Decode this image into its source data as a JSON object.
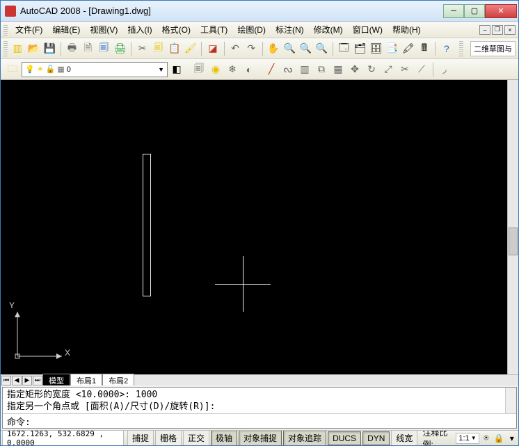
{
  "window": {
    "title": "AutoCAD 2008 - [Drawing1.dwg]"
  },
  "menu": {
    "items": [
      "文件(F)",
      "编辑(E)",
      "视图(V)",
      "插入(I)",
      "格式(O)",
      "工具(T)",
      "绘图(D)",
      "标注(N)",
      "修改(M)",
      "窗口(W)",
      "帮助(H)"
    ]
  },
  "toolbar_extra": "二维草图与",
  "layer": {
    "current": "0"
  },
  "tabs": {
    "items": [
      "模型",
      "布局1",
      "布局2"
    ],
    "active": 0
  },
  "command": {
    "history": [
      "指定矩形的宽度 <10.0000>: 1000",
      "指定另一个角点或 [面积(A)/尺寸(D)/旋转(R)]:"
    ],
    "prompt": "命令:",
    "input": ""
  },
  "status": {
    "coords": "1672.1263, 532.6829 , 0.0000",
    "buttons": [
      {
        "label": "捕捉",
        "active": false
      },
      {
        "label": "栅格",
        "active": false
      },
      {
        "label": "正交",
        "active": false
      },
      {
        "label": "极轴",
        "active": true
      },
      {
        "label": "对象捕捉",
        "active": true
      },
      {
        "label": "对象追踪",
        "active": true
      },
      {
        "label": "DUCS",
        "active": true
      },
      {
        "label": "DYN",
        "active": true
      },
      {
        "label": "线宽",
        "active": false
      }
    ],
    "annot_label": "注释比例:",
    "scale": "1:1"
  },
  "ucs": {
    "x": "X",
    "y": "Y"
  }
}
